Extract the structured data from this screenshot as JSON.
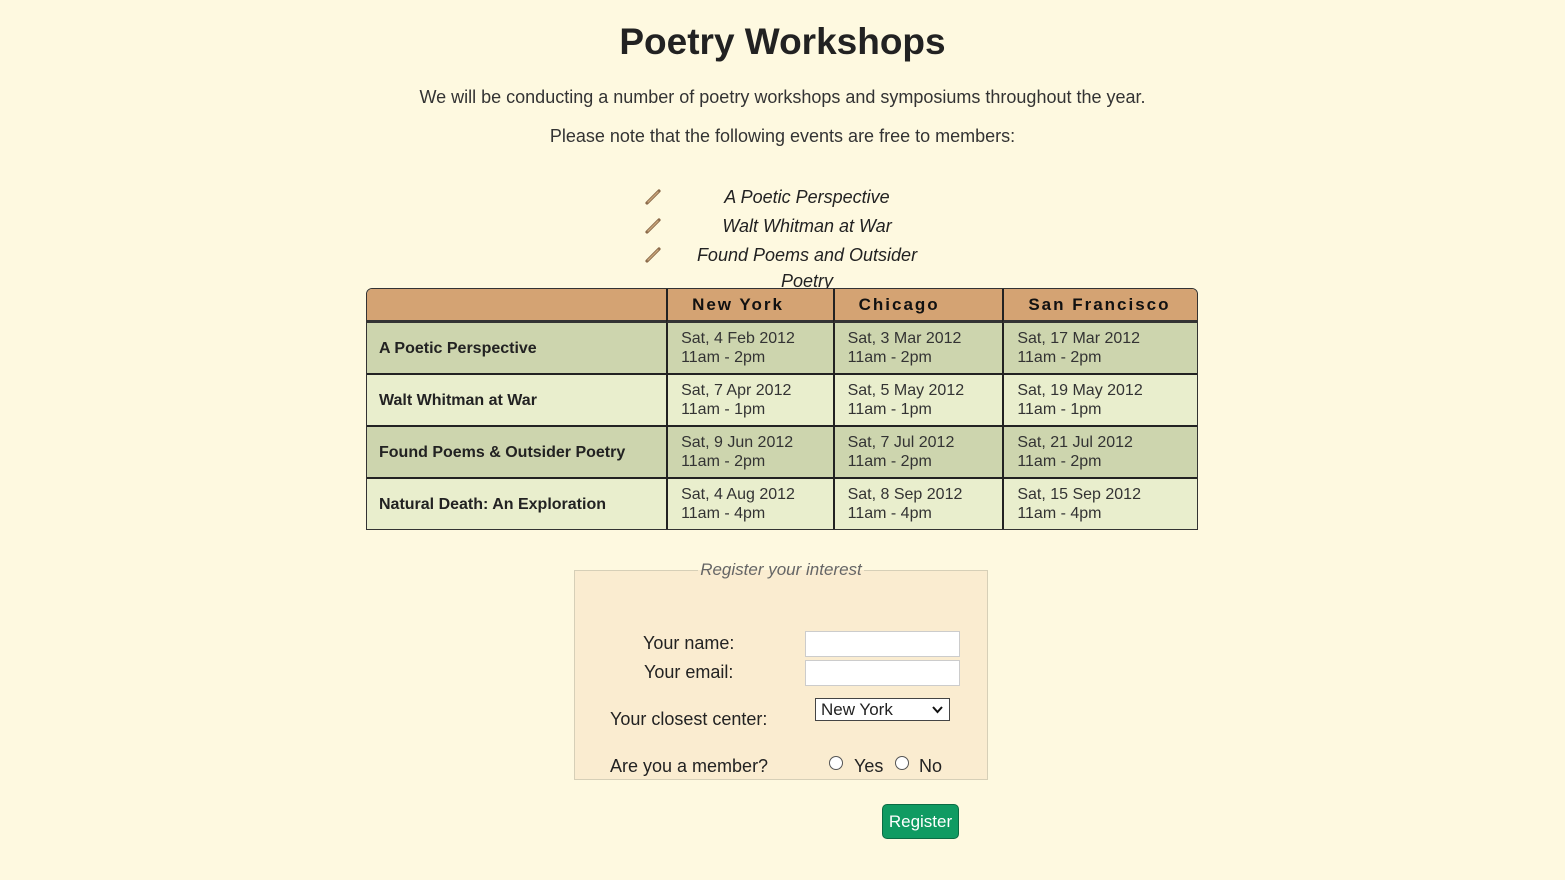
{
  "page": {
    "title": "Poetry Workshops",
    "intro_1": "We will be conducting a number of poetry workshops and symposiums throughout the year.",
    "intro_2": "Please note that the following events are free to members:"
  },
  "free_events": [
    {
      "label": "A Poetic Perspective",
      "icon": "pencil-icon"
    },
    {
      "label": "Walt Whitman at War",
      "icon": "pencil-icon"
    },
    {
      "label": "Found Poems and Outsider Poetry",
      "icon": "pencil-icon"
    }
  ],
  "schedule": {
    "columns": [
      "",
      "New York",
      "Chicago",
      "San Francisco"
    ],
    "rows": [
      {
        "workshop": "A Poetic Perspective",
        "cells": [
          {
            "date": "Sat, 4 Feb 2012",
            "time": "11am - 2pm"
          },
          {
            "date": "Sat, 3 Mar 2012",
            "time": "11am - 2pm"
          },
          {
            "date": "Sat, 17 Mar 2012",
            "time": "11am - 2pm"
          }
        ]
      },
      {
        "workshop": "Walt Whitman at War",
        "cells": [
          {
            "date": "Sat, 7 Apr 2012",
            "time": "11am - 1pm"
          },
          {
            "date": "Sat, 5 May 2012",
            "time": "11am - 1pm"
          },
          {
            "date": "Sat, 19 May 2012",
            "time": "11am - 1pm"
          }
        ]
      },
      {
        "workshop": "Found Poems & Outsider Poetry",
        "cells": [
          {
            "date": "Sat, 9 Jun 2012",
            "time": "11am - 2pm"
          },
          {
            "date": "Sat, 7 Jul 2012",
            "time": "11am - 2pm"
          },
          {
            "date": "Sat, 21 Jul 2012",
            "time": "11am - 2pm"
          }
        ]
      },
      {
        "workshop": "Natural Death: An Exploration",
        "cells": [
          {
            "date": "Sat, 4 Aug 2012",
            "time": "11am - 4pm"
          },
          {
            "date": "Sat, 8 Sep 2012",
            "time": "11am - 4pm"
          },
          {
            "date": "Sat, 15 Sep 2012",
            "time": "11am - 4pm"
          }
        ]
      }
    ]
  },
  "form": {
    "legend": "Register your interest",
    "name_label": "Your name:",
    "name_value": "",
    "email_label": "Your email:",
    "email_value": "",
    "center_label": "Your closest center:",
    "center_selected": "New York",
    "member_label": "Are you a member?",
    "yes_label": "Yes",
    "no_label": "No",
    "submit_label": "Register"
  },
  "colors": {
    "background": "#fef9e0",
    "header_row": "#d4a373",
    "row_odd": "#cdd5ae",
    "row_even": "#e9eecd",
    "form_bg": "#faecd0",
    "button": "#109b62"
  }
}
